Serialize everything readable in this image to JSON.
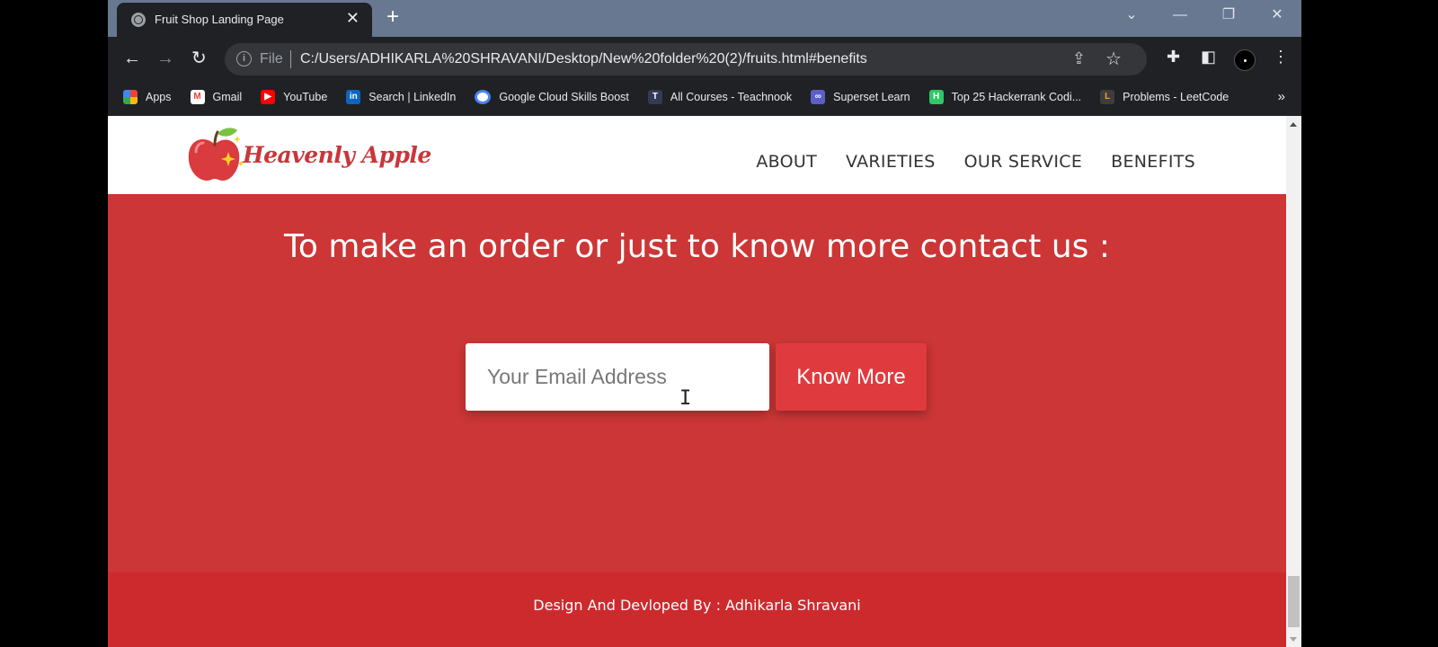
{
  "browser": {
    "tab_title": "Fruit Shop Landing Page",
    "new_tab_icon": "plus-icon",
    "file_label": "File",
    "url": "C:/Users/ADHIKARLA%20SHRAVANI/Desktop/New%20folder%20(2)/fruits.html#benefits",
    "bookmarks": [
      {
        "label": "Apps",
        "icon": "apps-grid-icon",
        "color": "#4285f4"
      },
      {
        "label": "Gmail",
        "icon": "gmail-icon",
        "color": "#ea4335"
      },
      {
        "label": "YouTube",
        "icon": "youtube-icon",
        "color": "#ff0000"
      },
      {
        "label": "Search | LinkedIn",
        "icon": "linkedin-icon",
        "color": "#0a66c2"
      },
      {
        "label": "Google Cloud Skills Boost",
        "icon": "google-cloud-icon",
        "color": "#4285f4"
      },
      {
        "label": "All Courses - Teachnook",
        "icon": "teachnook-icon",
        "color": "#333a55"
      },
      {
        "label": "Superset Learn",
        "icon": "superset-icon",
        "color": "#5b5fc7"
      },
      {
        "label": "Top 25 Hackerrank Codi...",
        "icon": "hackerrank-icon",
        "color": "#2ec866"
      },
      {
        "label": "Problems - LeetCode",
        "icon": "leetcode-icon",
        "color": "#ffa116"
      }
    ]
  },
  "site": {
    "brand": "Heavenly Apple",
    "nav": [
      "ABOUT",
      "VARIETIES",
      "OUR SERVICE",
      "BENEFITS"
    ],
    "contact_heading": "To make an order or just to know more contact us :",
    "email_placeholder": "Your Email Address",
    "cta_label": "Know More",
    "footer_text": "Design And Devloped By : Adhikarla Shravani",
    "colors": {
      "section_red": "#cc3636",
      "footer_red": "#cd2a2e",
      "button_red": "#df3b3e",
      "brand_red": "#c9363a"
    }
  }
}
